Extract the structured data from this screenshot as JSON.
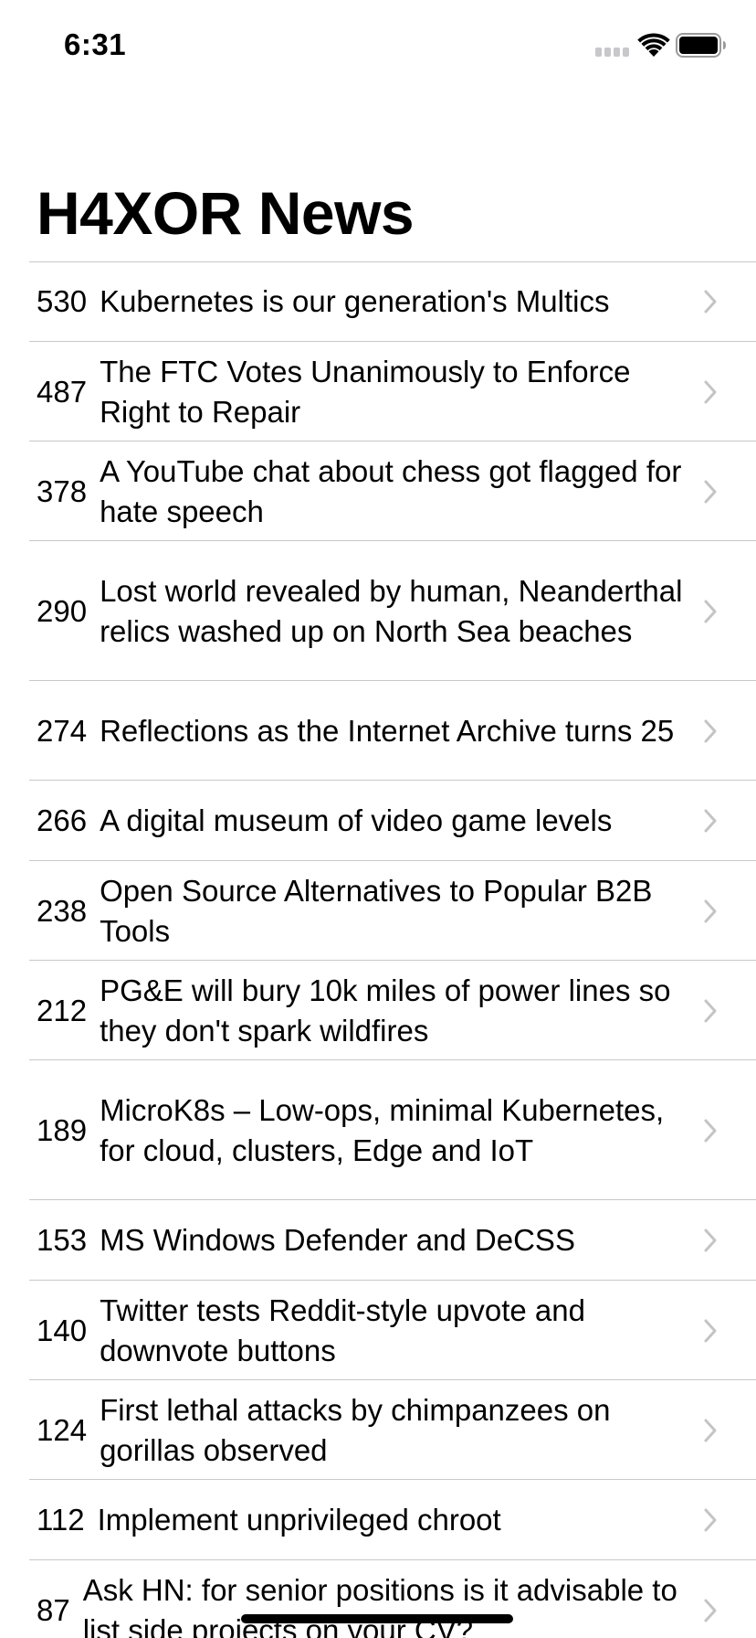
{
  "status_bar": {
    "time": "6:31",
    "icons": [
      "signal-icon",
      "wifi-icon",
      "battery-icon"
    ]
  },
  "header": {
    "title": "H4XOR News"
  },
  "stories": [
    {
      "points": "530",
      "title": "Kubernetes is our generation's Multics"
    },
    {
      "points": "487",
      "title": "The FTC Votes Unanimously to Enforce Right to Repair"
    },
    {
      "points": "378",
      "title": "A YouTube chat about chess got flagged for hate speech"
    },
    {
      "points": "290",
      "title": "Lost world revealed by human, Neanderthal relics washed up on North Sea beaches"
    },
    {
      "points": "274",
      "title": "Reflections as the Internet Archive turns 25"
    },
    {
      "points": "266",
      "title": "A digital museum of video game levels"
    },
    {
      "points": "238",
      "title": "Open Source Alternatives to Popular B2B Tools"
    },
    {
      "points": "212",
      "title": "PG&E will bury 10k miles of power lines so they don't spark wildfires"
    },
    {
      "points": "189",
      "title": "MicroK8s – Low-ops, minimal Kubernetes, for cloud, clusters, Edge and IoT"
    },
    {
      "points": "153",
      "title": "MS Windows Defender and DeCSS"
    },
    {
      "points": "140",
      "title": "Twitter tests Reddit-style upvote and downvote buttons"
    },
    {
      "points": "124",
      "title": "First lethal attacks by chimpanzees on gorillas observed"
    },
    {
      "points": "112",
      "title": "Implement unprivileged chroot"
    },
    {
      "points": "87",
      "title": "Ask HN: for senior positions is it advisable to list side projects on your CV?"
    }
  ],
  "colors": {
    "separator": "#c8c7cc",
    "chevron": "#c4c4c7",
    "text": "#000000",
    "background": "#ffffff"
  }
}
